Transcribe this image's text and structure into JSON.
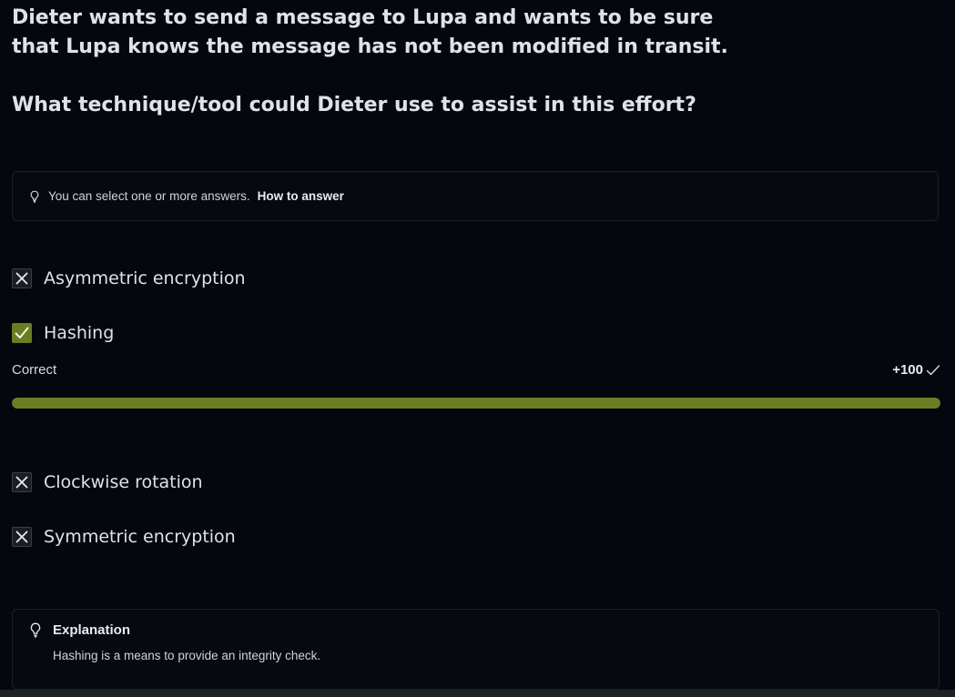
{
  "question": {
    "line1": "Dieter wants to send a message to Lupa and wants to be sure that Lupa knows the message has not been modified in transit.",
    "line2": "What technique/tool could Dieter use to assist in this effort?"
  },
  "hint": {
    "icon": "lightbulb-icon",
    "text": "You can select one or more answers.",
    "link": "How to answer"
  },
  "options": [
    {
      "label": "Asymmetric encryption",
      "state": "incorrect",
      "icon": "x-icon"
    },
    {
      "label": "Hashing",
      "state": "correct",
      "icon": "check-icon"
    },
    {
      "label": "Clockwise rotation",
      "state": "incorrect",
      "icon": "x-icon"
    },
    {
      "label": "Symmetric encryption",
      "state": "incorrect",
      "icon": "x-icon"
    }
  ],
  "result": {
    "status": "Correct",
    "score": "+100",
    "score_icon": "check-icon",
    "progress_percent": 100
  },
  "explanation": {
    "icon": "lightbulb-icon",
    "title": "Explanation",
    "text": "Hashing is a means to provide an integrity check."
  },
  "colors": {
    "background": "#04070d",
    "accent_green": "#6b7d23",
    "text": "#dfe2e7"
  }
}
